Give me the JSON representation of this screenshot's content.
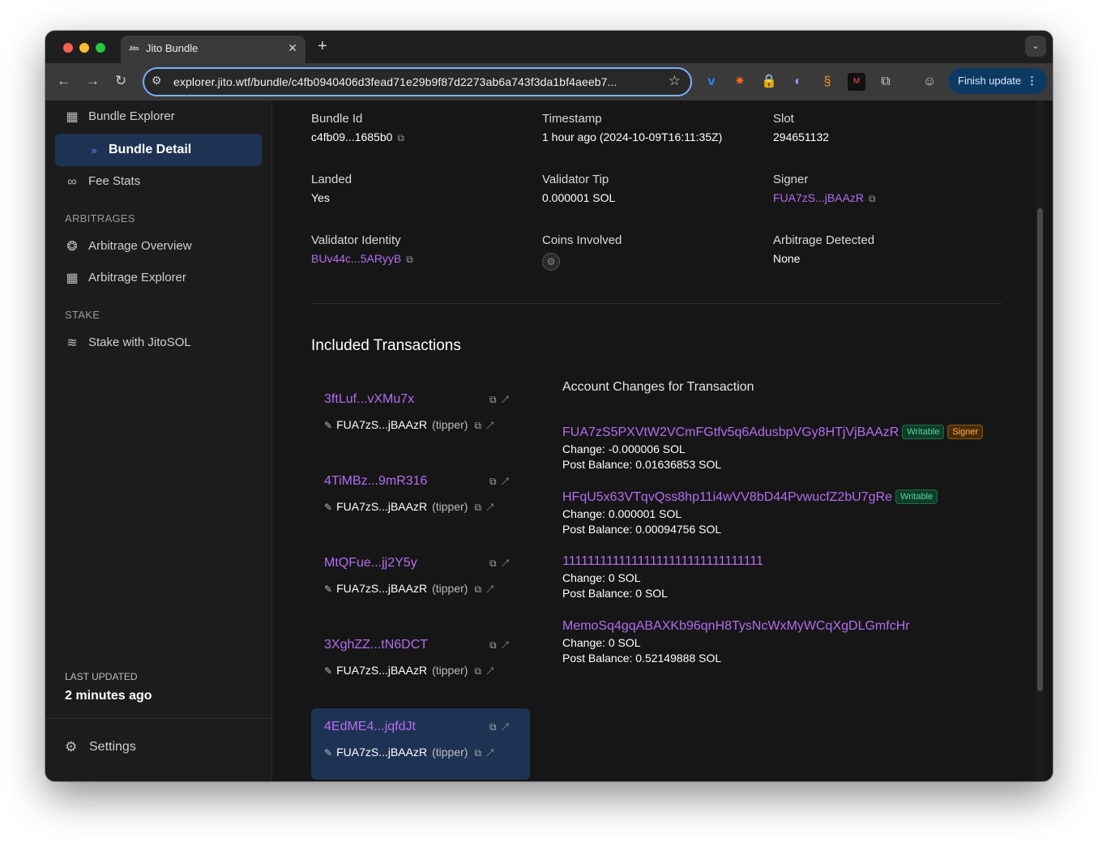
{
  "browser": {
    "tab_title": "Jito Bundle",
    "tab_favicon": "Jito",
    "url": "explorer.jito.wtf/bundle/c4fb0940406d3fead71e29b9f87d2273ab6a743f3da1bf4aeeb7...",
    "finish_update": "Finish update"
  },
  "sidebar": {
    "items": [
      {
        "label": "Bundle Explorer",
        "icon": "grid-icon"
      },
      {
        "label": "Bundle Detail",
        "icon": "chevron-double-right-icon"
      },
      {
        "label": "Fee Stats",
        "icon": "binoculars-icon"
      }
    ],
    "arbitrages_heading": "ARBITRAGES",
    "arbitrage_items": [
      {
        "label": "Arbitrage Overview",
        "icon": "coins-icon"
      },
      {
        "label": "Arbitrage Explorer",
        "icon": "grid-icon"
      }
    ],
    "stake_heading": "STAKE",
    "stake_items": [
      {
        "label": "Stake with JitoSOL",
        "icon": "layers-icon"
      }
    ],
    "last_updated_label": "LAST UPDATED",
    "last_updated_value": "2 minutes ago",
    "settings_label": "Settings"
  },
  "bundle": {
    "bundle_id_label": "Bundle Id",
    "bundle_id": "c4fb09...1685b0",
    "timestamp_label": "Timestamp",
    "timestamp": "1 hour ago (2024-10-09T16:11:35Z)",
    "slot_label": "Slot",
    "slot": "294651132",
    "landed_label": "Landed",
    "landed": "Yes",
    "validator_tip_label": "Validator Tip",
    "validator_tip": "0.000001 SOL",
    "signer_label": "Signer",
    "signer": "FUA7zS...jBAAzR",
    "validator_identity_label": "Validator Identity",
    "validator_identity": "BUv44c...5ARyyB",
    "coins_involved_label": "Coins Involved",
    "arbitrage_detected_label": "Arbitrage Detected",
    "arbitrage_detected": "None"
  },
  "included_transactions_title": "Included Transactions",
  "transactions": [
    {
      "sig": "3ftLuf...vXMu7x",
      "signer": "FUA7zS...jBAAzR",
      "role": "(tipper)"
    },
    {
      "sig": "4TiMBz...9mR316",
      "signer": "FUA7zS...jBAAzR",
      "role": "(tipper)"
    },
    {
      "sig": "MtQFue...jj2Y5y",
      "signer": "FUA7zS...jBAAzR",
      "role": "(tipper)"
    },
    {
      "sig": "3XghZZ...tN6DCT",
      "signer": "FUA7zS...jBAAzR",
      "role": "(tipper)"
    },
    {
      "sig": "4EdME4...jqfdJt",
      "signer": "FUA7zS...jBAAzR",
      "role": "(tipper)"
    }
  ],
  "account_changes_title": "Account Changes for Transaction",
  "accounts": [
    {
      "address": "FUA7zS5PXVtW2VCmFGtfv5q6AdusbpVGy8HTjVjBAAzR",
      "badges": [
        "Writable",
        "Signer"
      ],
      "change": "Change: -0.000006 SOL",
      "post": "Post Balance: 0.01636853 SOL"
    },
    {
      "address": "HFqU5x63VTqvQss8hp11i4wVV8bD44PvwucfZ2bU7gRe",
      "badges": [
        "Writable"
      ],
      "change": "Change: 0.000001 SOL",
      "post": "Post Balance: 0.00094756 SOL"
    },
    {
      "address": "11111111111111111111111111111111",
      "badges": [],
      "change": "Change: 0 SOL",
      "post": "Post Balance: 0 SOL"
    },
    {
      "address": "MemoSq4gqABAXKb96qnH8TysNcWxMyWCqXgDLGmfcHr",
      "badges": [],
      "change": "Change: 0 SOL",
      "post": "Post Balance: 0.52149888 SOL"
    }
  ],
  "colors": {
    "accent_purple": "#b46cf0",
    "selected_bg": "#1e3354",
    "writable": "#5ad39a",
    "signer": "#ffb24d"
  }
}
